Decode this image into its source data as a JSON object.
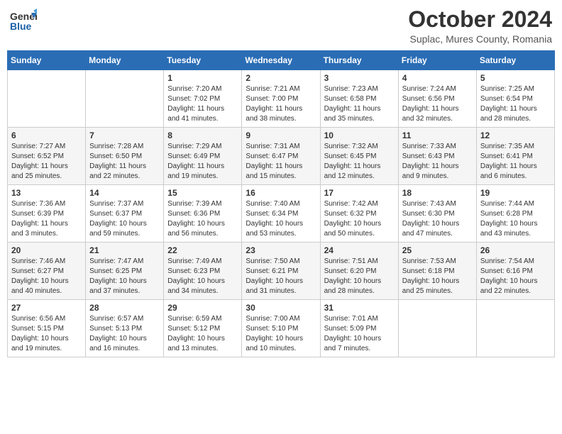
{
  "header": {
    "logo": {
      "line1": "General",
      "line2": "Blue"
    },
    "title": "October 2024",
    "location": "Suplac, Mures County, Romania"
  },
  "days_of_week": [
    "Sunday",
    "Monday",
    "Tuesday",
    "Wednesday",
    "Thursday",
    "Friday",
    "Saturday"
  ],
  "weeks": [
    [
      {
        "day": "",
        "info": ""
      },
      {
        "day": "",
        "info": ""
      },
      {
        "day": "1",
        "info": "Sunrise: 7:20 AM\nSunset: 7:02 PM\nDaylight: 11 hours and 41 minutes."
      },
      {
        "day": "2",
        "info": "Sunrise: 7:21 AM\nSunset: 7:00 PM\nDaylight: 11 hours and 38 minutes."
      },
      {
        "day": "3",
        "info": "Sunrise: 7:23 AM\nSunset: 6:58 PM\nDaylight: 11 hours and 35 minutes."
      },
      {
        "day": "4",
        "info": "Sunrise: 7:24 AM\nSunset: 6:56 PM\nDaylight: 11 hours and 32 minutes."
      },
      {
        "day": "5",
        "info": "Sunrise: 7:25 AM\nSunset: 6:54 PM\nDaylight: 11 hours and 28 minutes."
      }
    ],
    [
      {
        "day": "6",
        "info": "Sunrise: 7:27 AM\nSunset: 6:52 PM\nDaylight: 11 hours and 25 minutes."
      },
      {
        "day": "7",
        "info": "Sunrise: 7:28 AM\nSunset: 6:50 PM\nDaylight: 11 hours and 22 minutes."
      },
      {
        "day": "8",
        "info": "Sunrise: 7:29 AM\nSunset: 6:49 PM\nDaylight: 11 hours and 19 minutes."
      },
      {
        "day": "9",
        "info": "Sunrise: 7:31 AM\nSunset: 6:47 PM\nDaylight: 11 hours and 15 minutes."
      },
      {
        "day": "10",
        "info": "Sunrise: 7:32 AM\nSunset: 6:45 PM\nDaylight: 11 hours and 12 minutes."
      },
      {
        "day": "11",
        "info": "Sunrise: 7:33 AM\nSunset: 6:43 PM\nDaylight: 11 hours and 9 minutes."
      },
      {
        "day": "12",
        "info": "Sunrise: 7:35 AM\nSunset: 6:41 PM\nDaylight: 11 hours and 6 minutes."
      }
    ],
    [
      {
        "day": "13",
        "info": "Sunrise: 7:36 AM\nSunset: 6:39 PM\nDaylight: 11 hours and 3 minutes."
      },
      {
        "day": "14",
        "info": "Sunrise: 7:37 AM\nSunset: 6:37 PM\nDaylight: 10 hours and 59 minutes."
      },
      {
        "day": "15",
        "info": "Sunrise: 7:39 AM\nSunset: 6:36 PM\nDaylight: 10 hours and 56 minutes."
      },
      {
        "day": "16",
        "info": "Sunrise: 7:40 AM\nSunset: 6:34 PM\nDaylight: 10 hours and 53 minutes."
      },
      {
        "day": "17",
        "info": "Sunrise: 7:42 AM\nSunset: 6:32 PM\nDaylight: 10 hours and 50 minutes."
      },
      {
        "day": "18",
        "info": "Sunrise: 7:43 AM\nSunset: 6:30 PM\nDaylight: 10 hours and 47 minutes."
      },
      {
        "day": "19",
        "info": "Sunrise: 7:44 AM\nSunset: 6:28 PM\nDaylight: 10 hours and 43 minutes."
      }
    ],
    [
      {
        "day": "20",
        "info": "Sunrise: 7:46 AM\nSunset: 6:27 PM\nDaylight: 10 hours and 40 minutes."
      },
      {
        "day": "21",
        "info": "Sunrise: 7:47 AM\nSunset: 6:25 PM\nDaylight: 10 hours and 37 minutes."
      },
      {
        "day": "22",
        "info": "Sunrise: 7:49 AM\nSunset: 6:23 PM\nDaylight: 10 hours and 34 minutes."
      },
      {
        "day": "23",
        "info": "Sunrise: 7:50 AM\nSunset: 6:21 PM\nDaylight: 10 hours and 31 minutes."
      },
      {
        "day": "24",
        "info": "Sunrise: 7:51 AM\nSunset: 6:20 PM\nDaylight: 10 hours and 28 minutes."
      },
      {
        "day": "25",
        "info": "Sunrise: 7:53 AM\nSunset: 6:18 PM\nDaylight: 10 hours and 25 minutes."
      },
      {
        "day": "26",
        "info": "Sunrise: 7:54 AM\nSunset: 6:16 PM\nDaylight: 10 hours and 22 minutes."
      }
    ],
    [
      {
        "day": "27",
        "info": "Sunrise: 6:56 AM\nSunset: 5:15 PM\nDaylight: 10 hours and 19 minutes."
      },
      {
        "day": "28",
        "info": "Sunrise: 6:57 AM\nSunset: 5:13 PM\nDaylight: 10 hours and 16 minutes."
      },
      {
        "day": "29",
        "info": "Sunrise: 6:59 AM\nSunset: 5:12 PM\nDaylight: 10 hours and 13 minutes."
      },
      {
        "day": "30",
        "info": "Sunrise: 7:00 AM\nSunset: 5:10 PM\nDaylight: 10 hours and 10 minutes."
      },
      {
        "day": "31",
        "info": "Sunrise: 7:01 AM\nSunset: 5:09 PM\nDaylight: 10 hours and 7 minutes."
      },
      {
        "day": "",
        "info": ""
      },
      {
        "day": "",
        "info": ""
      }
    ]
  ]
}
